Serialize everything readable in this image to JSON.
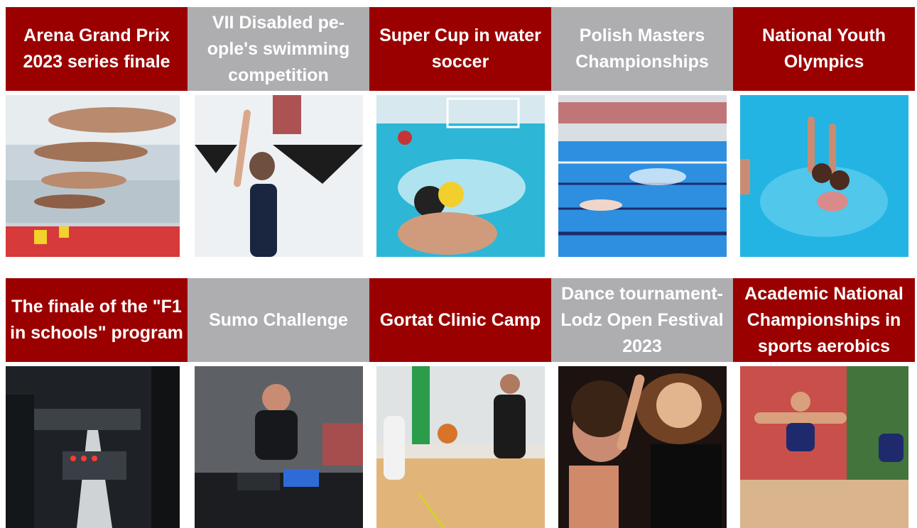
{
  "colors": {
    "red": "#9b0000",
    "grey": "#aeaeb1"
  },
  "tiles_row1": [
    {
      "title": "Arena Grand Prix 2023 series finale",
      "image": "swimmers-diving-photo"
    },
    {
      "title": "VII Disabled pe-ople's swimming competition",
      "image": "disabled-swimmer-photo"
    },
    {
      "title": "Super Cup in water soccer",
      "image": "water-polo-photo"
    },
    {
      "title": "Polish Masters Championships",
      "image": "masters-pool-photo"
    },
    {
      "title": "National Youth Olympics",
      "image": "synchronized-swimming-photo"
    }
  ],
  "tiles_row2": [
    {
      "title": "The finale of the \"F1 in schools\" program",
      "image": "f1-track-photo"
    },
    {
      "title": "Sumo Challenge",
      "image": "sumo-robot-photo"
    },
    {
      "title": "Gortat Clinic Camp",
      "image": "basketball-camp-photo"
    },
    {
      "title": "Dance tournament-Lodz Open Festival 2023",
      "image": "dance-couple-photo"
    },
    {
      "title": "Academic National Championships in sports aerobics",
      "image": "aerobics-photo"
    }
  ]
}
